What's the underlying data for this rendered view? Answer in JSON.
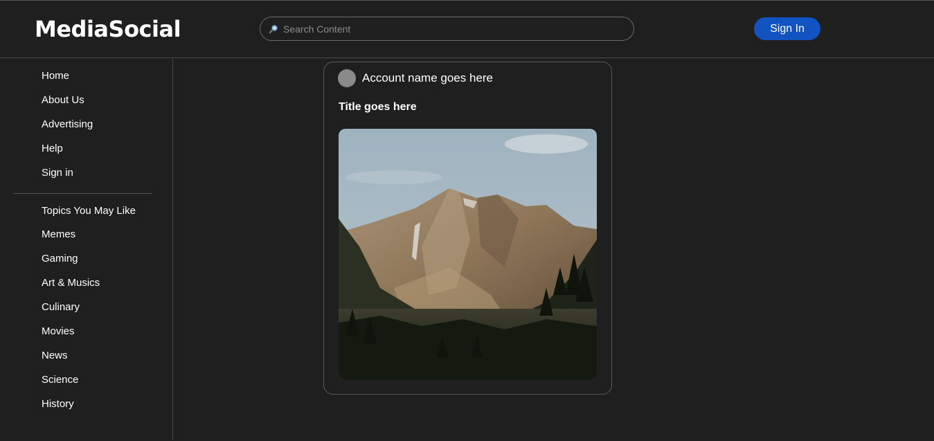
{
  "header": {
    "logo": "MediaSocial",
    "search": {
      "placeholder": "Search Content",
      "value": "",
      "icon": "search-icon"
    },
    "signin_label": "Sign In",
    "signin_color": "#1153c0"
  },
  "sidebar": {
    "nav": [
      {
        "label": "Home"
      },
      {
        "label": "About Us"
      },
      {
        "label": "Advertising"
      },
      {
        "label": "Help"
      },
      {
        "label": "Sign in"
      }
    ],
    "topics_heading": "Topics You May Like",
    "topics": [
      {
        "label": "Memes"
      },
      {
        "label": "Gaming"
      },
      {
        "label": "Art & Musics"
      },
      {
        "label": "Culinary"
      },
      {
        "label": "Movies"
      },
      {
        "label": "News"
      },
      {
        "label": "Science"
      },
      {
        "label": "History"
      }
    ]
  },
  "post": {
    "account_name": "Account name goes here",
    "title": "Title goes here",
    "image": "mountain-landscape"
  },
  "colors": {
    "background": "#1f1f1f",
    "text": "#ffffff",
    "border": "#5a5a5a",
    "accent": "#1153c0"
  }
}
